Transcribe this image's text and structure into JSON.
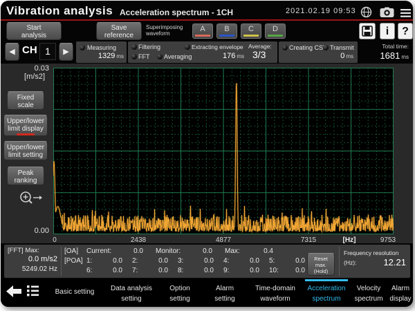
{
  "header": {
    "app_title": "Vibration analysis",
    "screen_title": "Acceleration spectrum - 1CH",
    "datetime": "2021.02.19 09:53"
  },
  "toolbar": {
    "start_button": {
      "line1": "Start",
      "line2": "analysis"
    },
    "save_button": {
      "line1": "Save",
      "line2": "reference"
    },
    "superimposing_label": {
      "line1": "Superimposing",
      "line2": "waveform"
    },
    "waveform_buttons": [
      {
        "label": "A",
        "color": "#d96a5a"
      },
      {
        "label": "B",
        "color": "#2b55c8"
      },
      {
        "label": "C",
        "color": "#cfc24a"
      },
      {
        "label": "D",
        "color": "#57a646"
      }
    ],
    "info_label": "i",
    "help_label": "?"
  },
  "channel_bar": {
    "ch_label": "CH",
    "ch_value": "1",
    "measuring": {
      "label": "Measuring",
      "value": "1329",
      "unit": "ms"
    },
    "filtering_label": "Filtering",
    "fft_label": "FFT",
    "averaging_label": "Averaging",
    "extracting": {
      "label": "Extracting envelope",
      "value": "176",
      "unit": "ms"
    },
    "average": {
      "label": "Average:",
      "value": "3/3"
    },
    "creating_csv_label": "Creating CSV",
    "transmit": {
      "label": "Transmit",
      "value": "0",
      "unit": "ms"
    },
    "total_time": {
      "label": "Total time:",
      "value": "1681",
      "unit": "ms"
    }
  },
  "side_buttons": {
    "fixed_scale": {
      "line1": "Fixed",
      "line2": "scale"
    },
    "limit_display": {
      "line1": "Upper/lower",
      "line2": "limit display"
    },
    "limit_setting": {
      "line1": "Upper/lower",
      "line2": "limit setting"
    },
    "peak_ranking": {
      "line1": "Peak",
      "line2": "ranking"
    }
  },
  "chart": {
    "y_max": "0.03",
    "y_unit": "[m/s2]",
    "y_min": "0.00",
    "ticks": [
      "0",
      "2438",
      "4877",
      "7315",
      "9753"
    ],
    "x_unit": "[Hz]"
  },
  "chart_data": {
    "type": "line",
    "title": "Acceleration spectrum - 1CH",
    "xlabel": "[Hz]",
    "ylabel": "[m/s2]",
    "xlim": [
      0,
      9753
    ],
    "ylim": [
      0,
      0.03
    ],
    "x_ticks": [
      0,
      2438,
      4877,
      7315,
      9753
    ],
    "y_tick_labels": [
      "0.00",
      "0.03"
    ],
    "grid": true,
    "grid_major_cols": 8,
    "grid_major_rows": 4,
    "grid_minor_per_major": 5,
    "major_grid_color": "#1e7d52",
    "minor_grid_color": "#11502f",
    "trace_color": "#f0a634",
    "noise_floor": {
      "mean_ms2": 0.0015,
      "max_ms2": 0.005,
      "seed": 13
    },
    "peaks": [
      {
        "freq_hz": 20,
        "amp_ms2": 0.0132,
        "width_hz": 30
      },
      {
        "freq_hz": 130,
        "amp_ms2": 0.005,
        "width_hz": 90
      },
      {
        "freq_hz": 5249.02,
        "amp_ms2": 0.0277,
        "width_hz": 22
      }
    ]
  },
  "info_panel": {
    "fft": {
      "label": "[FFT] Max:",
      "value": "0.0 m/s2",
      "freq": "5249.02 Hz"
    },
    "oa": {
      "label": "[OA]",
      "items": [
        {
          "k": "Current:",
          "v": "0.0"
        },
        {
          "k": "Monitor:",
          "v": "0.0"
        },
        {
          "k": "Max:",
          "v": "0.4"
        }
      ]
    },
    "poa": {
      "label": "[POA]",
      "row1": [
        {
          "k": "1:",
          "v": "0.0"
        },
        {
          "k": "2:",
          "v": "0.0"
        },
        {
          "k": "3:",
          "v": "0.0"
        },
        {
          "k": "4:",
          "v": "0.0"
        },
        {
          "k": "5:",
          "v": "0.0"
        }
      ],
      "row2": [
        {
          "k": "6:",
          "v": "0.0"
        },
        {
          "k": "7:",
          "v": "0.0"
        },
        {
          "k": "8:",
          "v": "0.0"
        },
        {
          "k": "9:",
          "v": "0.0"
        },
        {
          "k": "10:",
          "v": "0.0"
        }
      ]
    },
    "reset_button": {
      "line1": "Reset",
      "line2": "max.",
      "line3": "(Hold)"
    },
    "freq_resolution": {
      "label": "Frequency resolution",
      "sub": "(Hz):",
      "value": "12.21"
    }
  },
  "nav": {
    "active_color": "#33bdef",
    "tabs": [
      {
        "line1": "Basic setting",
        "line2": "",
        "active": false
      },
      {
        "line1": "Data analysis",
        "line2": "setting",
        "active": false
      },
      {
        "line1": "Option",
        "line2": "setting",
        "active": false
      },
      {
        "line1": "Alarm",
        "line2": "setting",
        "active": false
      },
      {
        "line1": "Time-domain",
        "line2": "waveform",
        "active": false
      },
      {
        "line1": "Acceleration",
        "line2": "spectrum",
        "active": true
      },
      {
        "line1": "Velocity",
        "line2": "spectrum",
        "active": false
      },
      {
        "line1": "Alarm",
        "line2": "display",
        "active": false
      }
    ]
  }
}
